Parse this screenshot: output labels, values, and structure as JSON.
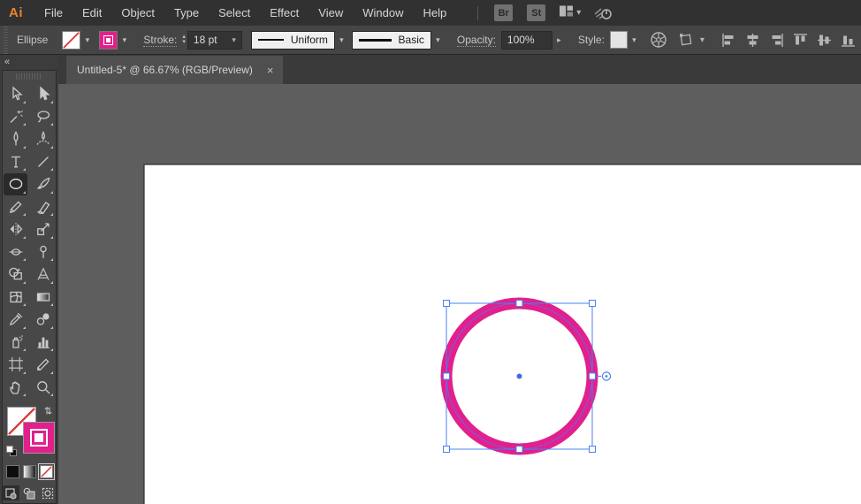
{
  "app": {
    "logo_label": "Ai"
  },
  "menu_bar": {
    "items": [
      "File",
      "Edit",
      "Object",
      "Type",
      "Select",
      "Effect",
      "View",
      "Window",
      "Help"
    ],
    "bridge_button": "Br",
    "stock_button": "St"
  },
  "control_bar": {
    "context_label": "Ellipse",
    "fill_swatch": "none",
    "stroke_swatch_color": "#e2208c",
    "stroke_label": "Stroke:",
    "stroke_weight_value": "18 pt",
    "width_profile_value": "Uniform",
    "brush_value": "Basic",
    "opacity_label": "Opacity:",
    "opacity_value": "100%",
    "style_label": "Style:",
    "align_buttons": [
      "align-horizontal-left",
      "align-horizontal-center",
      "align-horizontal-right",
      "align-vertical-top",
      "align-vertical-center",
      "align-vertical-bottom"
    ]
  },
  "document_tab": {
    "title": "Untitled-5* @ 66.67% (RGB/Preview)",
    "close_glyph": "×"
  },
  "toolbar": {
    "collapse_glyph": "«",
    "selected_tool": "ellipse-tool",
    "tools": [
      "selection-tool",
      "direct-selection-tool",
      "magic-wand-tool",
      "lasso-tool",
      "pen-tool",
      "curvature-tool",
      "type-tool",
      "line-segment-tool",
      "ellipse-tool",
      "paintbrush-tool",
      "pencil-tool",
      "eraser-tool",
      "rotate-tool",
      "scale-tool",
      "width-tool",
      "puppet-warp-tool",
      "shape-builder-tool",
      "perspective-grid-tool",
      "mesh-tool",
      "gradient-tool",
      "eyedropper-tool",
      "blend-tool",
      "symbol-sprayer-tool",
      "column-graph-tool",
      "artboard-tool",
      "slice-tool",
      "hand-tool",
      "zoom-tool"
    ],
    "fill_type": "none",
    "stroke_color": "#e2208c",
    "color_buttons": [
      "color",
      "gradient",
      "none"
    ],
    "active_color_button": "none",
    "drawing_modes": [
      "draw-normal",
      "draw-behind",
      "draw-inside"
    ],
    "active_drawing_mode": "draw-normal"
  },
  "canvas": {
    "artboard_color": "#ffffff",
    "selected_object": {
      "type": "ellipse",
      "fill": "none",
      "stroke_color": "#e2208c",
      "stroke_weight": "18 pt"
    }
  },
  "colors": {
    "accent_pink": "#e2208c",
    "selection_blue": "#4b80f0",
    "none_slash_red": "#dd3333",
    "logo_orange": "#e8862d",
    "menubar_bg": "#313131",
    "controlbar_bg": "#454545",
    "pasteboard_gray": "#5e5e5e"
  }
}
